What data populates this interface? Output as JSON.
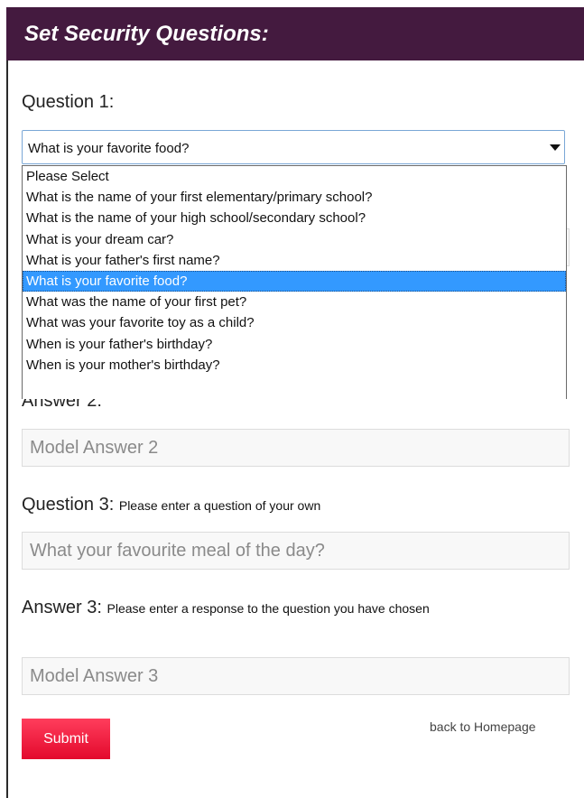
{
  "header": {
    "title": "Set Security Questions:"
  },
  "question1": {
    "label": "Question 1:",
    "selected_value": "What is your favorite food?",
    "options": [
      "Please Select",
      "What is the name of your first elementary/primary school?",
      "What is the name of your high school/secondary school?",
      "What is your dream car?",
      "What is your father's first name?",
      "What is your favorite food?",
      "What was the name of your first pet?",
      "What was your favorite toy as a child?",
      "When is your father's birthday?",
      "When is your mother's birthday?"
    ],
    "highlighted_index": 5
  },
  "answer2": {
    "label": "Answer 2:",
    "placeholder": "Model Answer 2"
  },
  "question3": {
    "label": "Question 3:",
    "hint": "Please enter a question of your own",
    "placeholder": "What your favourite meal of the day?"
  },
  "answer3": {
    "label": "Answer 3:",
    "hint": "Please enter a response to the question you have chosen",
    "placeholder": "Model Answer 3"
  },
  "actions": {
    "submit_label": "Submit",
    "back_link": "back to Homepage"
  },
  "colors": {
    "header_bg": "#441a3f",
    "submit_bg": "#f5153b",
    "highlight": "#3399ff"
  }
}
